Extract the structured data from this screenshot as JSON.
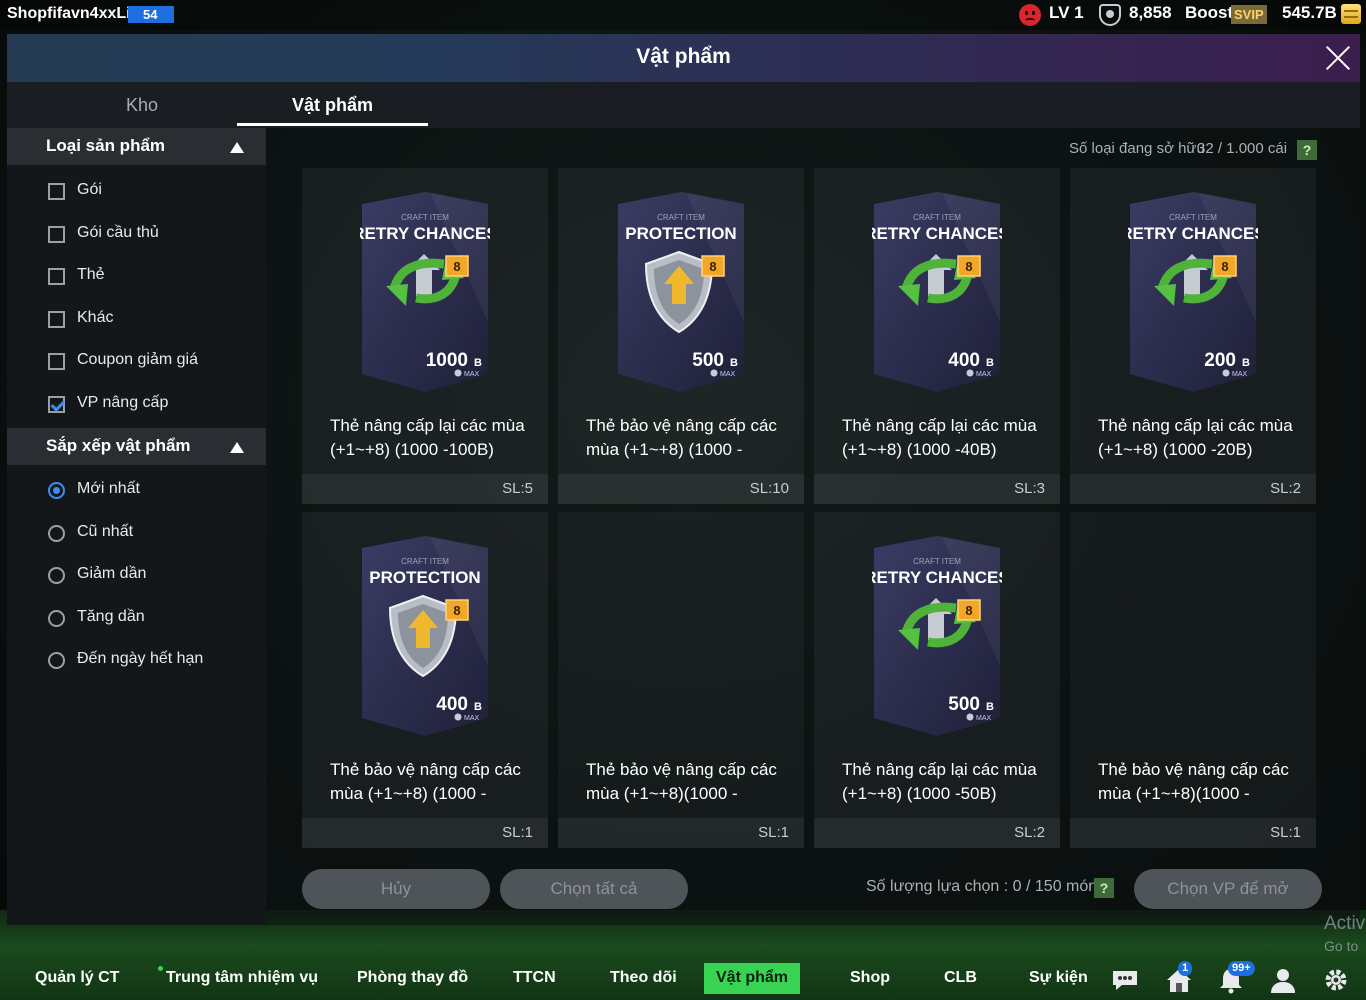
{
  "topbar": {
    "username": "Shopfifavn4xxLi",
    "level_badge": "54",
    "level": "LV 1",
    "fans": "8,858",
    "boost": "Boost",
    "svip": "SVIP",
    "currency": "545.7B"
  },
  "header": {
    "title": "Vật phẩm"
  },
  "tabs": [
    {
      "label": "Kho",
      "active": false
    },
    {
      "label": "Vật phẩm",
      "active": true
    }
  ],
  "sidebar": {
    "category_title": "Loại sản phẩm",
    "categories": [
      {
        "label": "Gói",
        "checked": false
      },
      {
        "label": "Gói cầu thủ",
        "checked": false
      },
      {
        "label": "Thẻ",
        "checked": false
      },
      {
        "label": "Khác",
        "checked": false
      },
      {
        "label": "Coupon giảm giá",
        "checked": false
      },
      {
        "label": "VP nâng cấp",
        "checked": true
      }
    ],
    "sort_title": "Sắp xếp vật phẩm",
    "sorts": [
      {
        "label": "Mới nhất",
        "selected": true
      },
      {
        "label": "Cũ nhất",
        "selected": false
      },
      {
        "label": "Giảm dần",
        "selected": false
      },
      {
        "label": "Tăng dần",
        "selected": false
      },
      {
        "label": "Đến ngày hết hạn",
        "selected": false
      }
    ]
  },
  "main": {
    "owned_label": "Số loại đang sở hữu",
    "owned_value": "32 / 1.000 cái",
    "help": "?",
    "items": [
      {
        "art": "retry",
        "top": "CRAFT ITEM",
        "title": "RETRY CHANCES",
        "level": "8",
        "value": "1000",
        "unit": "B",
        "max": "MAX",
        "name": "Thẻ nâng cấp lại các mùa (+1~+8) (1000 -100B)",
        "qty": "SL:5"
      },
      {
        "art": "protect",
        "top": "CRAFT ITEM",
        "title": "PROTECTION",
        "level": "8",
        "value": "500",
        "unit": "B",
        "max": "MAX",
        "name": "Thẻ bảo vệ nâng cấp các mùa (+1~+8) (1000 -",
        "qty": "SL:10"
      },
      {
        "art": "retry",
        "top": "CRAFT ITEM",
        "title": "RETRY CHANCES",
        "level": "8",
        "value": "400",
        "unit": "B",
        "max": "MAX",
        "name": "Thẻ nâng cấp lại các mùa (+1~+8) (1000 -40B)",
        "qty": "SL:3"
      },
      {
        "art": "retry",
        "top": "CRAFT ITEM",
        "title": "RETRY CHANCES",
        "level": "8",
        "value": "200",
        "unit": "B",
        "max": "MAX",
        "name": "Thẻ nâng cấp lại các mùa (+1~+8) (1000 -20B)",
        "qty": "SL:2"
      },
      {
        "art": "protect",
        "top": "CRAFT ITEM",
        "title": "PROTECTION",
        "level": "8",
        "value": "400",
        "unit": "B",
        "max": "MAX",
        "name": "Thẻ bảo vệ nâng cấp các mùa (+1~+8) (1000 -",
        "qty": "SL:1"
      },
      {
        "art": "none",
        "name": "Thẻ bảo vệ nâng cấp các mùa (+1~+8)(1000 -",
        "qty": "SL:1"
      },
      {
        "art": "retry",
        "top": "CRAFT ITEM",
        "title": "RETRY CHANCES",
        "level": "8",
        "value": "500",
        "unit": "B",
        "max": "MAX",
        "name": "Thẻ nâng cấp lại các mùa (+1~+8) (1000 -50B)",
        "qty": "SL:2"
      },
      {
        "art": "none",
        "name": "Thẻ bảo vệ nâng cấp các mùa (+1~+8)(1000 -",
        "qty": "SL:1"
      }
    ],
    "cancel": "Hủy",
    "select_all": "Chọn tất cả",
    "selection_label": "Số lượng lựa chọn : 0 / 150 món",
    "open": "Chọn VP để mở"
  },
  "bottomnav": {
    "items": [
      {
        "label": "Quản lý CT",
        "active": false
      },
      {
        "label": "Trung tâm nhiệm vụ",
        "active": false
      },
      {
        "label": "Phòng thay đồ",
        "active": false
      },
      {
        "label": "TTCN",
        "active": false
      },
      {
        "label": "Theo dõi",
        "active": false
      },
      {
        "label": "Vật phẩm",
        "active": true
      },
      {
        "label": "Shop",
        "active": false
      },
      {
        "label": "CLB",
        "active": false
      },
      {
        "label": "Sự kiện",
        "active": false
      }
    ],
    "home_badge": "1",
    "bell_badge": "99+"
  },
  "watermark": {
    "line1": "Activ",
    "line2": "Go to"
  },
  "colors": {
    "accent": "#39d353",
    "blue": "#3c8ef5",
    "card": "#2b2d45"
  }
}
